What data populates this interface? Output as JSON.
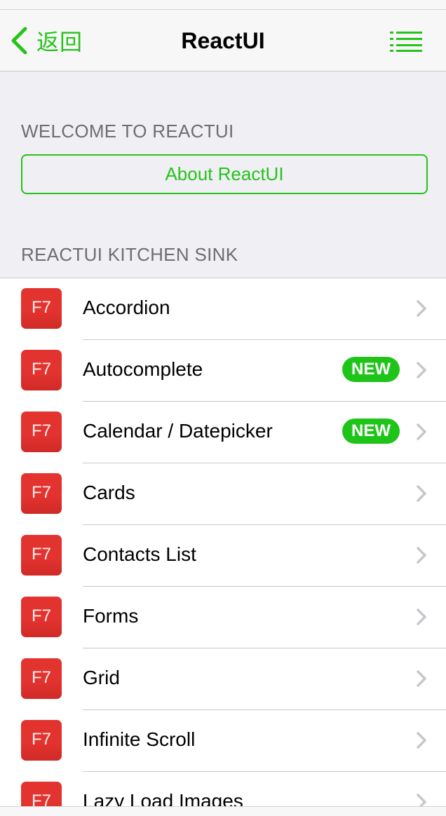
{
  "navbar": {
    "back_label": "返回",
    "title": "ReactUI"
  },
  "welcome": {
    "section_title": "WELCOME TO REACTUI",
    "button_label": "About ReactUI"
  },
  "kitchen": {
    "section_title": "REACTUI KITCHEN SINK",
    "icon_text": "F7",
    "items": [
      {
        "label": "Accordion",
        "badge": ""
      },
      {
        "label": "Autocomplete",
        "badge": "NEW"
      },
      {
        "label": "Calendar / Datepicker",
        "badge": "NEW"
      },
      {
        "label": "Cards",
        "badge": ""
      },
      {
        "label": "Contacts List",
        "badge": ""
      },
      {
        "label": "Forms",
        "badge": ""
      },
      {
        "label": "Grid",
        "badge": ""
      },
      {
        "label": "Infinite Scroll",
        "badge": ""
      },
      {
        "label": "Lazy Load Images",
        "badge": ""
      }
    ]
  },
  "colors": {
    "accent": "#26c31a",
    "icon_bg": "#e3332f",
    "badge_bg": "#1fc419"
  },
  "icons": {
    "back": "chevron-left-icon",
    "menu": "list-menu-icon",
    "disclosure": "chevron-right-icon"
  }
}
